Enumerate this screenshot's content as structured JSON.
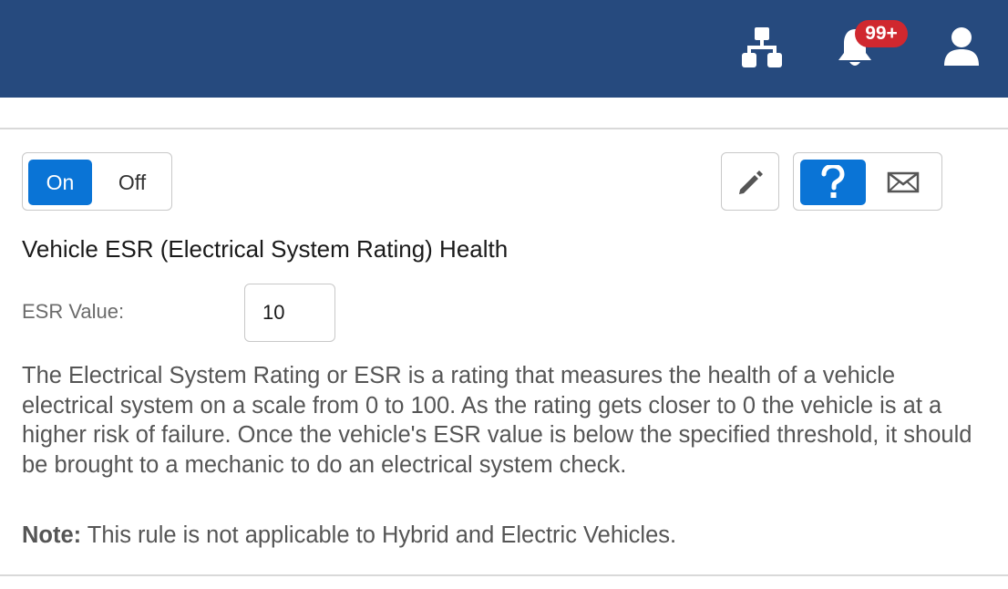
{
  "header": {
    "notification_count": "99+",
    "icons": {
      "org": "sitemap-icon",
      "notifications": "bell-icon",
      "user": "user-icon"
    },
    "bg_color": "#264a7e"
  },
  "toggle": {
    "on_label": "On",
    "off_label": "Off",
    "selected": "On",
    "accent_color": "#0a74d6"
  },
  "actions": {
    "edit_icon": "pencil-icon",
    "help_icon": "question-icon",
    "mail_icon": "envelope-icon"
  },
  "rule": {
    "title": "Vehicle ESR (Electrical System Rating) Health",
    "esr_label": "ESR Value:",
    "esr_value": "10",
    "description": "The Electrical System Rating or ESR is a rating that measures the health of a vehicle electrical system on a scale from 0 to 100. As the rating gets closer to 0 the vehicle is at a higher risk of failure. Once the vehicle's ESR value is below the specified threshold, it should be brought to a mechanic to do an electrical system check.",
    "note_label": "Note:",
    "note_text": " This rule is not applicable to Hybrid and Electric Vehicles."
  }
}
